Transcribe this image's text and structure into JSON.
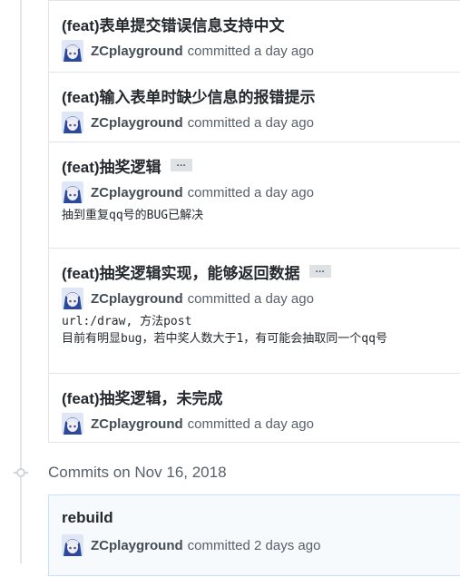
{
  "commits_top": [
    {
      "title": "(feat)表单提交错误信息支持中文",
      "author": "ZCplayground",
      "time": "committed a day ago"
    },
    {
      "title": "(feat)输入表单时缺少信息的报错提示",
      "author": "ZCplayground",
      "time": "committed a day ago"
    },
    {
      "title": "(feat)抽奖逻辑",
      "ellipsis": "…",
      "author": "ZCplayground",
      "time": "committed a day ago",
      "description": "抽到重复qq号的BUG已解决"
    },
    {
      "title": "(feat)抽奖逻辑实现，能够返回数据",
      "ellipsis": "…",
      "author": "ZCplayground",
      "time": "committed a day ago",
      "description_lines": [
        "url:/draw, 方法post",
        "目前有明显bug，若中奖人数大于1，有可能会抽取同一个qq号"
      ]
    },
    {
      "title": "(feat)抽奖逻辑，未完成",
      "author": "ZCplayground",
      "time": "committed a day ago"
    }
  ],
  "date_header": "Commits on Nov 16, 2018",
  "commits_bottom": [
    {
      "title": "rebuild",
      "author": "ZCplayground",
      "time": "committed 2 days ago"
    }
  ],
  "colors": {
    "timeline": "#e1e4e8",
    "title": "#24292e",
    "muted": "#586069",
    "avatar_blue": "#2b4a9b"
  },
  "icons": {
    "avatar": "anime-avatar-icon",
    "commit_node": "git-commit-icon"
  }
}
